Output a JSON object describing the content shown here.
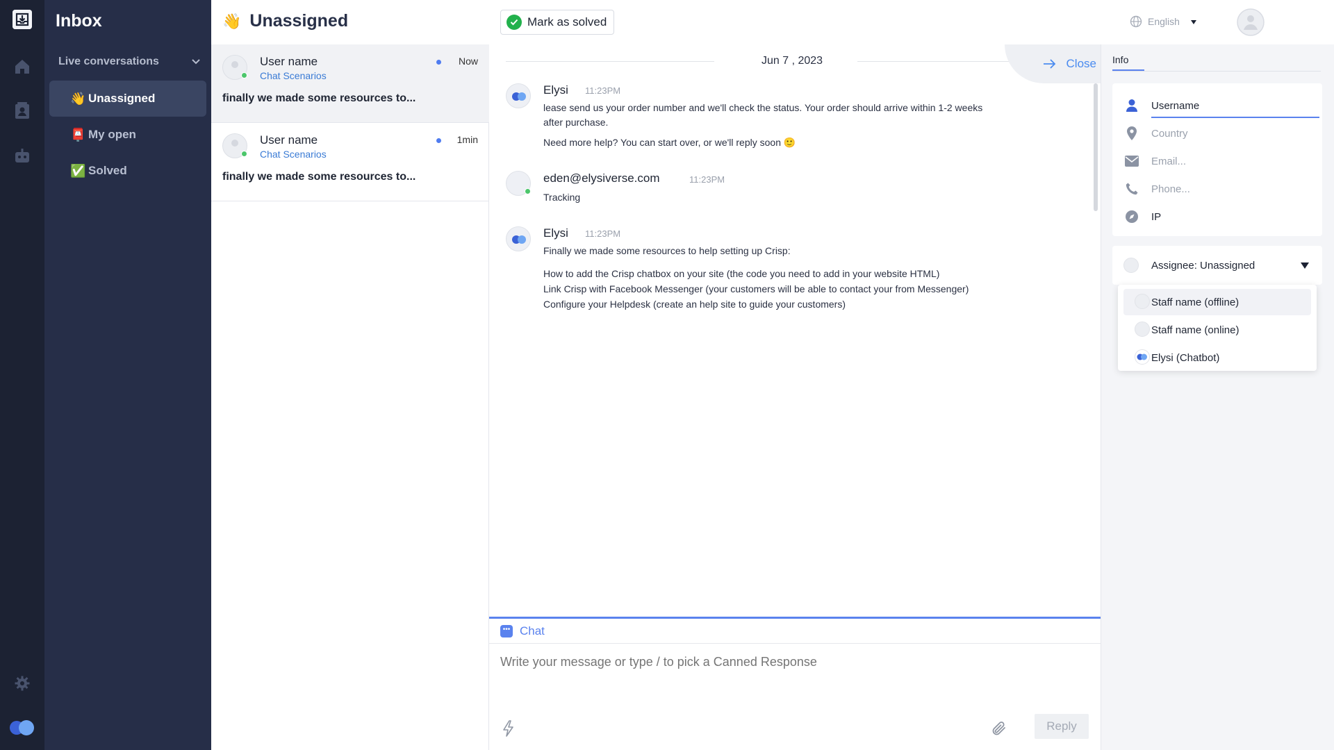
{
  "app": {
    "inbox_title": "Inbox"
  },
  "sidebar": {
    "section_label": "Live conversations",
    "items": [
      {
        "emoji": "👋",
        "label": "Unassigned",
        "active": true
      },
      {
        "emoji": "📮",
        "label": "My open",
        "active": false
      },
      {
        "emoji": "✅",
        "label": "Solved",
        "active": false
      }
    ]
  },
  "header": {
    "emoji": "👋",
    "title": "Unassigned",
    "mark_solved_label": "Mark as solved",
    "language": "English"
  },
  "conversations": [
    {
      "name": "User name",
      "scenario": "Chat Scenarios",
      "time": "Now",
      "preview": "finally we made some resources to..."
    },
    {
      "name": "User name",
      "scenario": "Chat Scenarios",
      "time": "1min",
      "preview": "finally we made some resources to..."
    }
  ],
  "chat": {
    "date": "Jun 7 , 2023",
    "close_label": "Close",
    "messages": [
      {
        "sender": "Elysi",
        "time": "11:23PM",
        "lines": [
          "lease send us your order number and we'll check the status. Your order should arrive within 1-2 weeks",
          "after purchase.",
          "Need more help? You can start over, or we'll reply soon 🙂"
        ]
      },
      {
        "sender": "eden@elysiverse.com",
        "time": "11:23PM",
        "lines": [
          "Tracking"
        ]
      },
      {
        "sender": "Elysi",
        "time": "11:23PM",
        "lines": [
          "Finally we made some resources to help setting up Crisp:",
          "How to add the Crisp chatbox on your site (the code you need to add in your website HTML)",
          "Link Crisp with Facebook Messenger (your customers will be able to contact your from Messenger)",
          "Configure your Helpdesk (create an help site to guide your customers)"
        ]
      }
    ]
  },
  "composer": {
    "tab_label": "Chat",
    "placeholder": "Write your message or type / to pick a Canned Response",
    "reply_label": "Reply"
  },
  "right_panel": {
    "tab_info": "Info",
    "fields": [
      {
        "icon": "user-icon",
        "label": "Username"
      },
      {
        "icon": "location-pin-icon",
        "label": "Country"
      },
      {
        "icon": "mail-icon",
        "label": "Email..."
      },
      {
        "icon": "phone-icon",
        "label": "Phone..."
      },
      {
        "icon": "compass-icon",
        "label": "IP"
      }
    ],
    "assignee_label": "Assignee: Unassigned",
    "assignee_options": [
      {
        "label": "Staff name (offline)"
      },
      {
        "label": "Staff name (online)"
      },
      {
        "label": "Elysi (Chatbot)"
      }
    ]
  },
  "colors": {
    "rail": "#1c2233",
    "sidebar": "#262e48",
    "accent": "#5a82ee",
    "link": "#3a7bd5",
    "online": "#4cc66b",
    "solved_green": "#22b14c"
  }
}
